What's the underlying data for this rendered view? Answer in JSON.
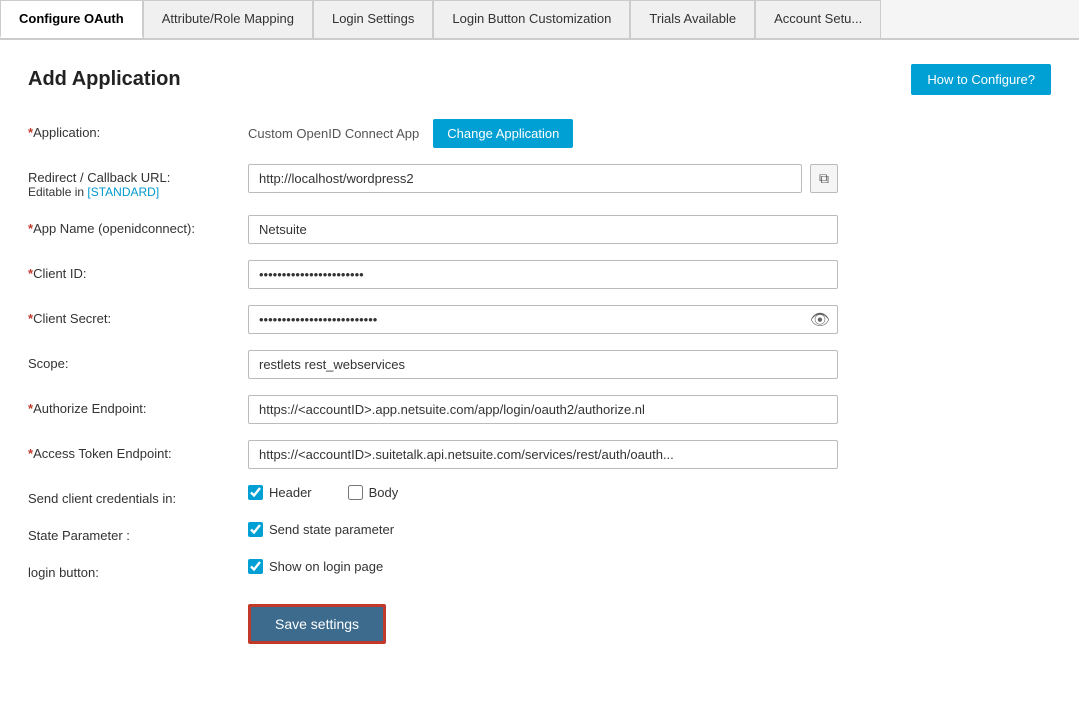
{
  "tabs": [
    {
      "id": "configure-oauth",
      "label": "Configure OAuth",
      "active": true
    },
    {
      "id": "attribute-role-mapping",
      "label": "Attribute/Role Mapping",
      "active": false
    },
    {
      "id": "login-settings",
      "label": "Login Settings",
      "active": false
    },
    {
      "id": "login-button-customization",
      "label": "Login Button Customization",
      "active": false
    },
    {
      "id": "trials-available",
      "label": "Trials Available",
      "active": false
    },
    {
      "id": "account-setup",
      "label": "Account Setu...",
      "active": false
    }
  ],
  "page": {
    "title": "Add Application",
    "how_to_configure_label": "How to Configure?"
  },
  "form": {
    "application_label": "*Application:",
    "application_value": "Custom OpenID Connect App",
    "change_button_label": "Change Application",
    "redirect_label": "Redirect / Callback URL:",
    "redirect_sub_label": "Editable in",
    "redirect_link_label": "[STANDARD]",
    "redirect_value": "http://localhost/wordpress2",
    "copy_icon": "⧉",
    "app_name_label": "*App Name (openidconnect):",
    "app_name_value": "Netsuite",
    "client_id_label": "*Client ID:",
    "client_id_value": "•••••••••••••••••••••••",
    "client_secret_label": "*Client Secret:",
    "client_secret_value": "••••••••••••••••••••••••••",
    "eye_icon": "👁",
    "scope_label": "Scope:",
    "scope_value": "restlets rest_webservices",
    "authorize_endpoint_label": "*Authorize Endpoint:",
    "authorize_endpoint_value": "https://<accountID>.app.netsuite.com/app/login/oauth2/authorize.nl",
    "access_token_label": "*Access Token Endpoint:",
    "access_token_value": "https://<accountID>.suitetalk.api.netsuite.com/services/rest/auth/oauth...",
    "send_credentials_label": "Send client credentials in:",
    "header_label": "Header",
    "body_label": "Body",
    "state_parameter_label": "State Parameter :",
    "state_parameter_check_label": "Send state parameter",
    "login_button_label": "login button:",
    "login_button_check_label": "Show on login page",
    "save_label": "Save settings"
  }
}
